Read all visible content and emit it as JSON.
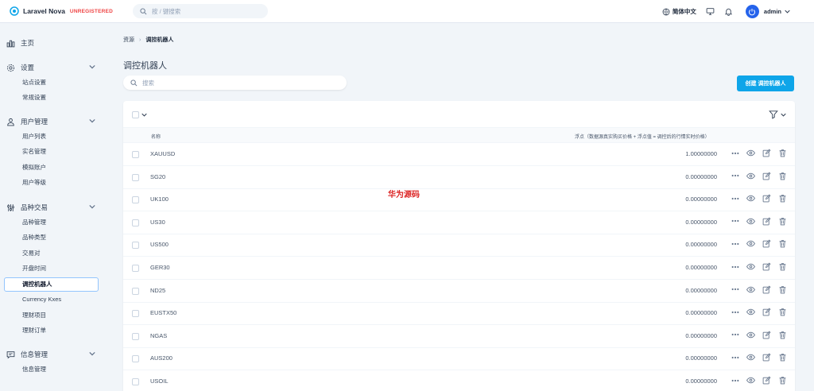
{
  "header": {
    "brand": "Laravel Nova",
    "unregistered": "UNREGISTERED",
    "search_placeholder": "按 / 键搜索",
    "language": "简体中文",
    "user": "admin"
  },
  "sidebar": {
    "sections": [
      {
        "label": "主页",
        "icon": "chart-bar-icon",
        "items": []
      },
      {
        "label": "设置",
        "icon": "gear-icon",
        "items": [
          "站点设置",
          "常规设置"
        ]
      },
      {
        "label": "用户管理",
        "icon": "users-icon",
        "items": [
          "用户列表",
          "实名管理",
          "模拟账户",
          "用户等级"
        ]
      },
      {
        "label": "品种交易",
        "icon": "adjustments-icon",
        "items": [
          "品种管理",
          "品种类型",
          "交易对",
          "开盘时间",
          "调控机器人",
          "Currency Kxes",
          "理财项目",
          "理财订单"
        ]
      },
      {
        "label": "信息管理",
        "icon": "chat-icon",
        "items": [
          "信息管理"
        ]
      }
    ],
    "active_item": "调控机器人"
  },
  "breadcrumb": {
    "root": "资源",
    "current": "调控机器人"
  },
  "page": {
    "title": "调控机器人",
    "search_placeholder": "搜索",
    "create_label": "创建 调控机器人"
  },
  "table": {
    "columns": [
      "名称",
      "浮点（数据源真实购买价格 + 浮点值 = 调控后的行情实时价格）"
    ],
    "rows": [
      {
        "name": "XAUUSD",
        "value": "1.00000000"
      },
      {
        "name": "SG20",
        "value": "0.00000000"
      },
      {
        "name": "UK100",
        "value": "0.00000000"
      },
      {
        "name": "US30",
        "value": "0.00000000"
      },
      {
        "name": "US500",
        "value": "0.00000000"
      },
      {
        "name": "GER30",
        "value": "0.00000000"
      },
      {
        "name": "ND25",
        "value": "0.00000000"
      },
      {
        "name": "EUSTX50",
        "value": "0.00000000"
      },
      {
        "name": "NGAS",
        "value": "0.00000000"
      },
      {
        "name": "AUS200",
        "value": "0.00000000"
      },
      {
        "name": "USOIL",
        "value": "0.00000000"
      }
    ]
  },
  "watermark": "华为源码",
  "colors": {
    "accent": "#0ea5e9",
    "danger": "#ef4444",
    "brand": "#0ea5e9"
  }
}
